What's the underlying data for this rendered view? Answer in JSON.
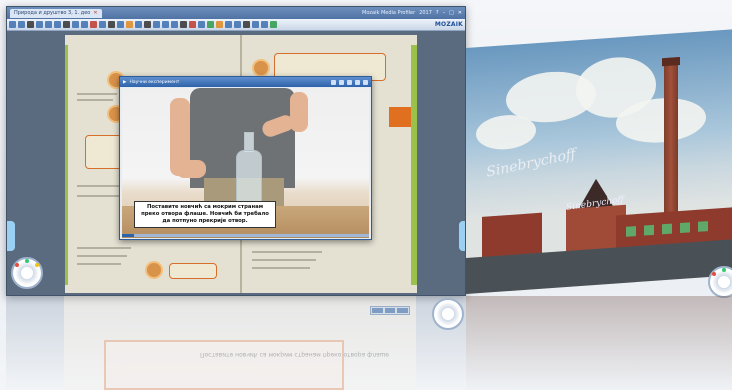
{
  "window": {
    "tab_title": "Природа и друштво 3, 1. део",
    "app_title": "Mozaik Mediа Profiler",
    "app_badge": "2017"
  },
  "toolbar": {
    "brand": "MOZAIK"
  },
  "player": {
    "title": "Научни експеримент",
    "subtitle": "Поставите новчић са мокрим странам преко отвора флаше. Новчић би требало да потпуно прекрије отвор.",
    "progress": 0.05
  },
  "photo": {
    "sign_main": "Sinebrychoff",
    "sign_small": "Sinebrychoff"
  },
  "reflection": {
    "text": "Поставите новчић са мокрим странам преко отвора флаше"
  },
  "colors": {
    "accent": "#2f63a9",
    "book_green": "#9ac14a",
    "book_orange": "#d76e2a"
  }
}
